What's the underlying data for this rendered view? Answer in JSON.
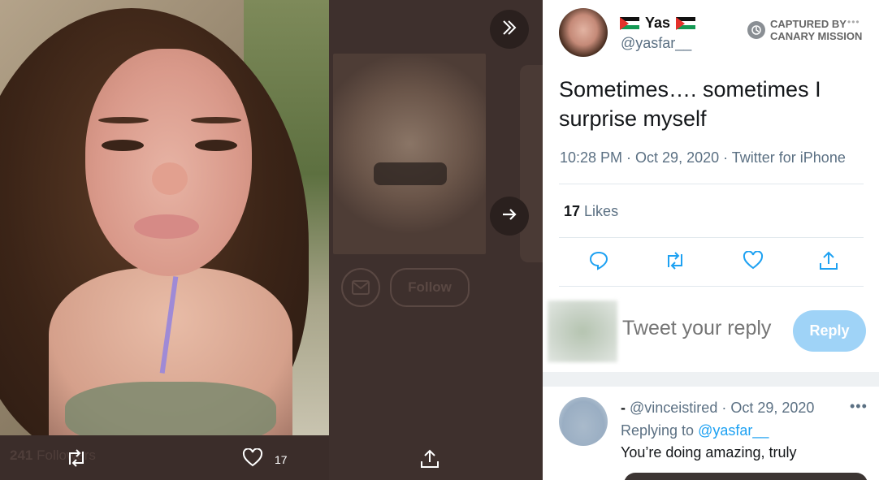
{
  "media_viewer": {
    "background_profile": {
      "follow_label": "Follow",
      "followers_count": "241",
      "followers_label": "Followers"
    },
    "actions": {
      "likes": "17"
    }
  },
  "tweet": {
    "author": {
      "display_name": "Yas",
      "handle": "@yasfar__"
    },
    "captured_by": {
      "line1": "CAPTURED BY",
      "line2": "CANARY MISSION",
      "dots": "•••"
    },
    "text": "Sometimes…. sometimes I surprise myself",
    "meta": "10:28 PM · Oct 29, 2020 · Twitter for iPhone",
    "likes": {
      "count": "17",
      "label": "Likes"
    }
  },
  "reply_composer": {
    "placeholder": "Tweet your reply",
    "button_label": "Reply"
  },
  "reply": {
    "name": "-",
    "handle_date": "@vinceistired · Oct 29, 2020",
    "more": "•••",
    "replying_prefix": "Replying to",
    "replying_to": "@yasfar__",
    "text": "You’re doing amazing, truly"
  },
  "colors": {
    "accent": "#1da1f2",
    "reply_button": "#9fd3f7",
    "secondary_text": "#5b7083",
    "viewer_background": "#3b2d2a"
  },
  "icons": {
    "collapse": "double-chevron-right-icon",
    "next": "arrow-right-icon",
    "reply": "speech-bubble-icon",
    "retweet": "retweet-icon",
    "like": "heart-icon",
    "share": "share-upload-icon",
    "captured": "canary-logo-icon",
    "flag": "palestine-flag-icon"
  }
}
